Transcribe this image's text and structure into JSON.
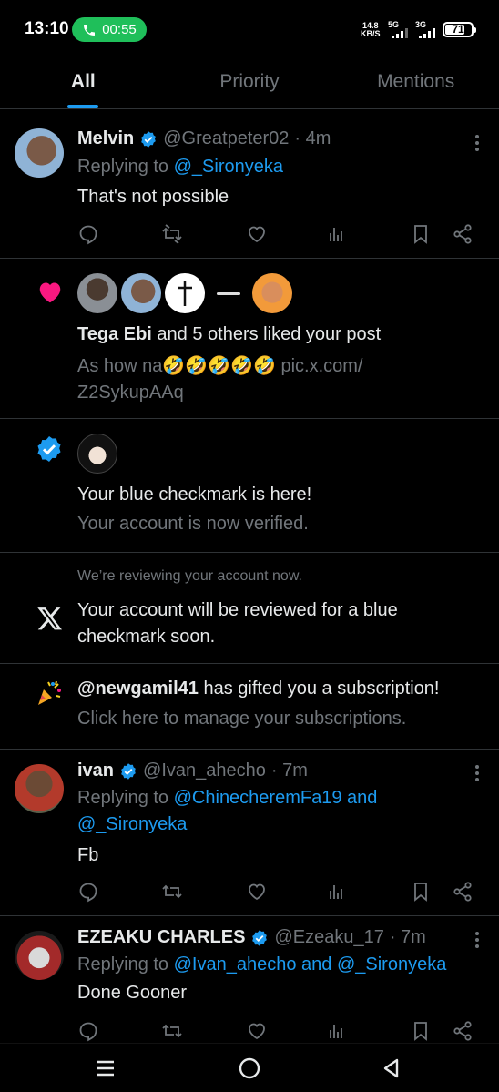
{
  "status": {
    "time": "13:10",
    "call_timer": "00:55",
    "net_speed_value": "14.8",
    "net_speed_unit": "KB/S",
    "sim1_label": "5G",
    "sim2_label": "3G",
    "battery": "71"
  },
  "tabs": [
    {
      "label": "All",
      "active": true
    },
    {
      "label": "Priority",
      "active": false
    },
    {
      "label": "Mentions",
      "active": false
    }
  ],
  "notifications": {
    "melvin": {
      "name": "Melvin",
      "handle": "@Greatpeter02",
      "time": "· 4m",
      "replying_prefix": "Replying to ",
      "replying_to": "@_Sironyeka",
      "text": "That's not possible"
    },
    "likes": {
      "bold": "Tega Ebi",
      "rest": " and 5 others liked your post",
      "preview_line1": "As how na🤣🤣🤣🤣🤣 pic.x.com/",
      "preview_line2": "Z2SykupAAq"
    },
    "checkmark": {
      "title": "Your blue checkmark is here!",
      "subtitle": "Your account is now verified."
    },
    "review": {
      "caption": "We’re reviewing your account now.",
      "line1": "Your account will be reviewed for a blue",
      "line2": "checkmark soon."
    },
    "gift": {
      "user": "@newgamil41",
      "rest": " has gifted you a subscription!",
      "subtitle": "Click here to manage your subscriptions."
    },
    "ivan": {
      "name": "ivan",
      "handle": "@Ivan_ahecho",
      "time": "· 7m",
      "replying_prefix": "Replying to ",
      "replying_to_1": "@ChinecheremFa19",
      "and": " and",
      "replying_to_2": "@_Sironyeka",
      "text": "Fb"
    },
    "ezeaku": {
      "name": "EZEAKU CHARLES",
      "handle": "@Ezeaku_17",
      "time": "· 7m",
      "replying_prefix": "Replying to ",
      "replying_to_1": "@Ivan_ahecho",
      "and": " and ",
      "replying_to_2": "@_Sironyeka",
      "text": "Done Gooner"
    }
  },
  "icons": [
    "phone-icon",
    "verified-icon",
    "more-icon",
    "reply-icon",
    "retweet-icon",
    "like-icon",
    "views-icon",
    "bookmark-icon",
    "share-icon",
    "heart-icon",
    "x-logo-icon",
    "party-popper-icon",
    "menu-icon",
    "home-circle-icon",
    "back-icon"
  ],
  "colors": {
    "accent": "#1d9bf0",
    "like": "#f91880",
    "call": "#1fbf5a",
    "background": "#000000"
  }
}
